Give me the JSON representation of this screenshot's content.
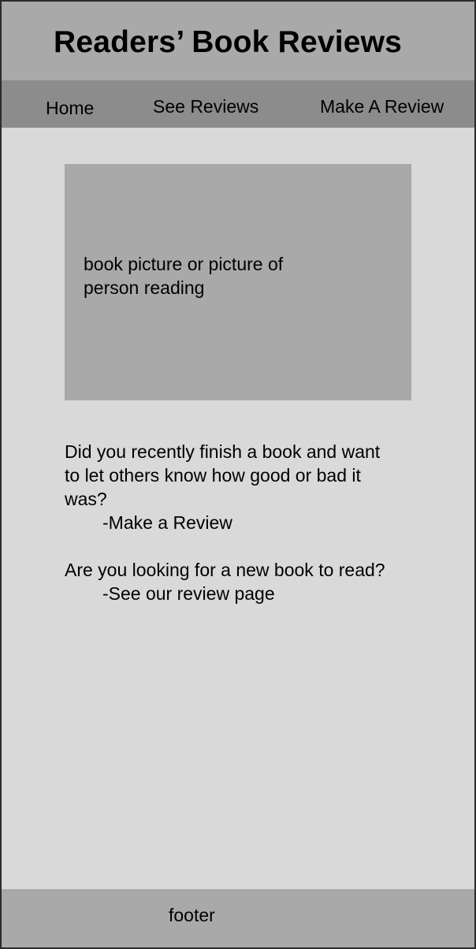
{
  "header": {
    "title": "Readers’ Book Reviews"
  },
  "nav": {
    "items": [
      {
        "label": "Home"
      },
      {
        "label": "See Reviews"
      },
      {
        "label": "Make A Review"
      }
    ]
  },
  "hero": {
    "placeholder_text": "book picture or picture of person reading"
  },
  "intro": {
    "question_1": "Did you recently finish a book and want to let others know how good or bad it was?",
    "link_1": "-Make a Review",
    "question_2": "Are you looking for a new book to read?",
    "link_2": "-See our review page"
  },
  "footer": {
    "label": "footer"
  },
  "colors": {
    "page_bg": "#d9d9d9",
    "header_bg": "#a9a9a9",
    "nav_bg": "#8c8c8c",
    "border": "#2b2b2b"
  }
}
